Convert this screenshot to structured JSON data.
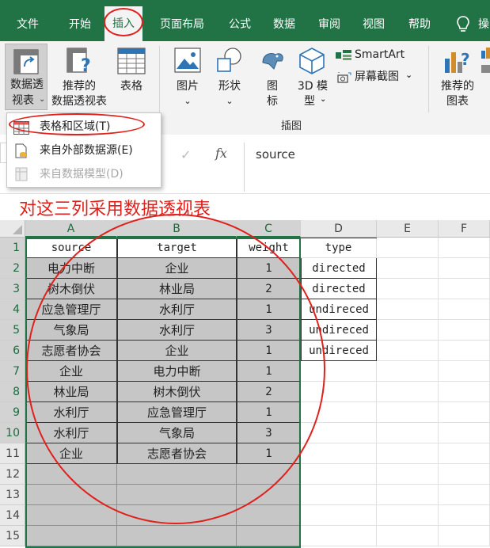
{
  "ribbon_tabs": [
    "文件",
    "开始",
    "插入",
    "页面布局",
    "公式",
    "数据",
    "审阅",
    "视图",
    "帮助",
    "操"
  ],
  "ribbon": {
    "pivot_line1": "数据透",
    "pivot_line2": "视表",
    "recommended_pivot_line1": "推荐的",
    "recommended_pivot_line2": "数据透视表",
    "table": "表格",
    "picture": "图片",
    "shapes": "形状",
    "icons_line1": "图",
    "icons_line2": "标",
    "model3d_line1": "3D 模",
    "model3d_line2": "型",
    "smartart": "SmartArt",
    "screenshot": "屏幕截图",
    "recommended_chart_line1": "推荐的",
    "recommended_chart_line2": "图表",
    "group_illustrations": "插图"
  },
  "dropdown": {
    "items": [
      {
        "label": "表格和区域(T)",
        "enabled": true
      },
      {
        "label": "来自外部数据源(E)",
        "enabled": true
      },
      {
        "label": "来自数据模型(D)",
        "enabled": false
      }
    ]
  },
  "formula_bar": {
    "fx": "fx",
    "value": "source"
  },
  "annotation": "对这三列采用数据透视表",
  "sheet": {
    "columns": [
      "A",
      "B",
      "C",
      "D",
      "E",
      "F"
    ],
    "rows": [
      "1",
      "2",
      "3",
      "4",
      "5",
      "6",
      "7",
      "8",
      "9",
      "10",
      "11",
      "12",
      "13",
      "14",
      "15"
    ],
    "headers": {
      "A": "source",
      "B": "target",
      "C": "weight",
      "D": "type"
    },
    "data": [
      {
        "source": "电力中断",
        "target": "企业",
        "weight": "1",
        "type": "directed"
      },
      {
        "source": "树木倒伏",
        "target": "林业局",
        "weight": "2",
        "type": "directed"
      },
      {
        "source": "应急管理厅",
        "target": "水利厅",
        "weight": "1",
        "type": "undireced"
      },
      {
        "source": "气象局",
        "target": "水利厅",
        "weight": "3",
        "type": "undireced"
      },
      {
        "source": "志愿者协会",
        "target": "企业",
        "weight": "1",
        "type": "undireced"
      },
      {
        "source": "企业",
        "target": "电力中断",
        "weight": "1",
        "type": ""
      },
      {
        "source": "林业局",
        "target": "树木倒伏",
        "weight": "2",
        "type": ""
      },
      {
        "source": "水利厅",
        "target": "应急管理厅",
        "weight": "1",
        "type": ""
      },
      {
        "source": "水利厅",
        "target": "气象局",
        "weight": "3",
        "type": ""
      },
      {
        "source": "企业",
        "target": "志愿者协会",
        "weight": "1",
        "type": ""
      }
    ]
  },
  "colors": {
    "excel_green": "#217346",
    "annotation_red": "#e0201b",
    "selection_gray": "#c6c6c6"
  }
}
